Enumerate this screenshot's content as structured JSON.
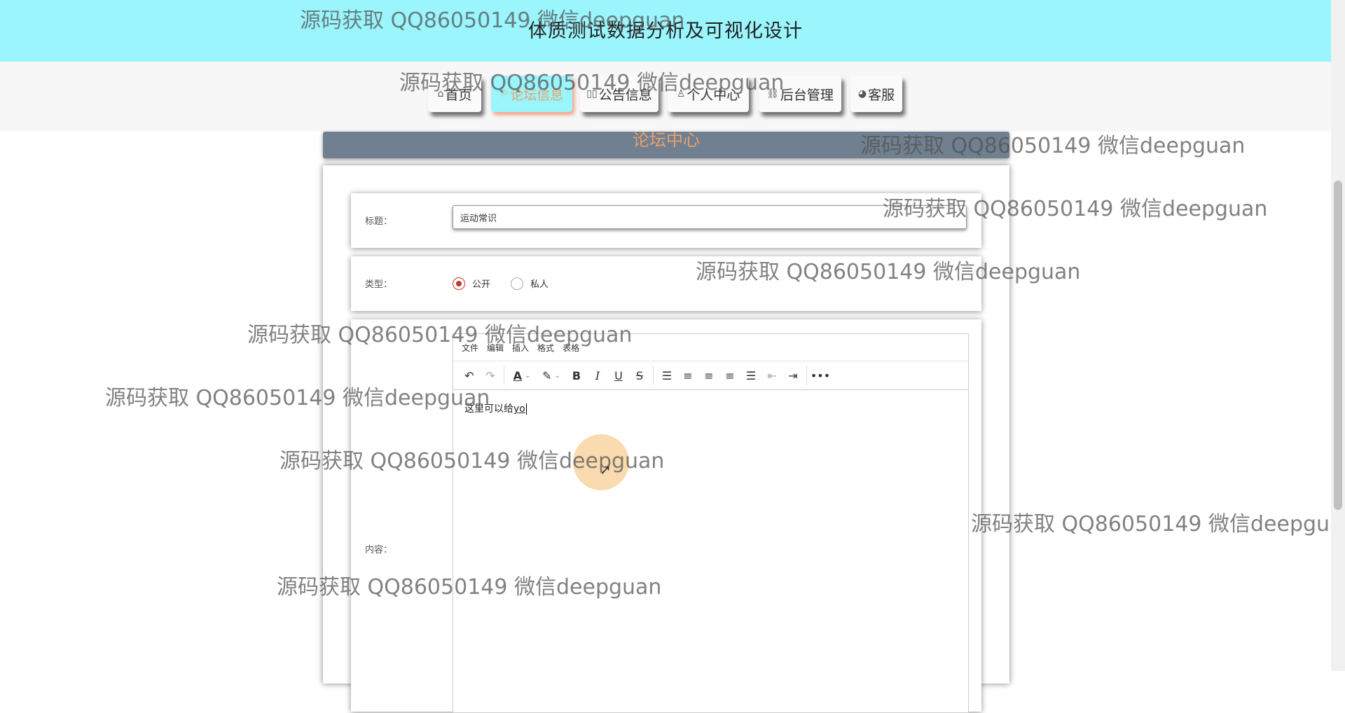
{
  "header": {
    "title": "体质测试数据分析及可视化设计"
  },
  "nav": {
    "items": [
      {
        "icon": "⌂",
        "label": "首页"
      },
      {
        "icon": "⚐",
        "label": "论坛信息"
      },
      {
        "icon": "▯▯",
        "label": "公告信息"
      },
      {
        "icon": "♙",
        "label": "个人中心"
      },
      {
        "icon": "⛓",
        "label": "后台管理"
      },
      {
        "icon": "◕",
        "label": "客服"
      }
    ],
    "active_index": 1,
    "active_color": "#9af5fd"
  },
  "banner": {
    "title": "论坛中心"
  },
  "form": {
    "title_label": "标题：",
    "title_value": "运动常识",
    "type_label": "类型：",
    "type_options": [
      {
        "label": "公开",
        "checked": true
      },
      {
        "label": "私人",
        "checked": false
      }
    ],
    "content_label": "内容：",
    "editor": {
      "menus": [
        "文件",
        "编辑",
        "插入",
        "格式",
        "表格"
      ],
      "content_text": "这里可以给",
      "content_composing": "yo"
    }
  },
  "watermark": {
    "text": "源码获取 QQ86050149 微信deepguan"
  },
  "colors": {
    "header_bg": "#9af5fd",
    "banner_bg": "#708090",
    "accent": "#e9a06a",
    "radio_checked": "#c0392b"
  }
}
